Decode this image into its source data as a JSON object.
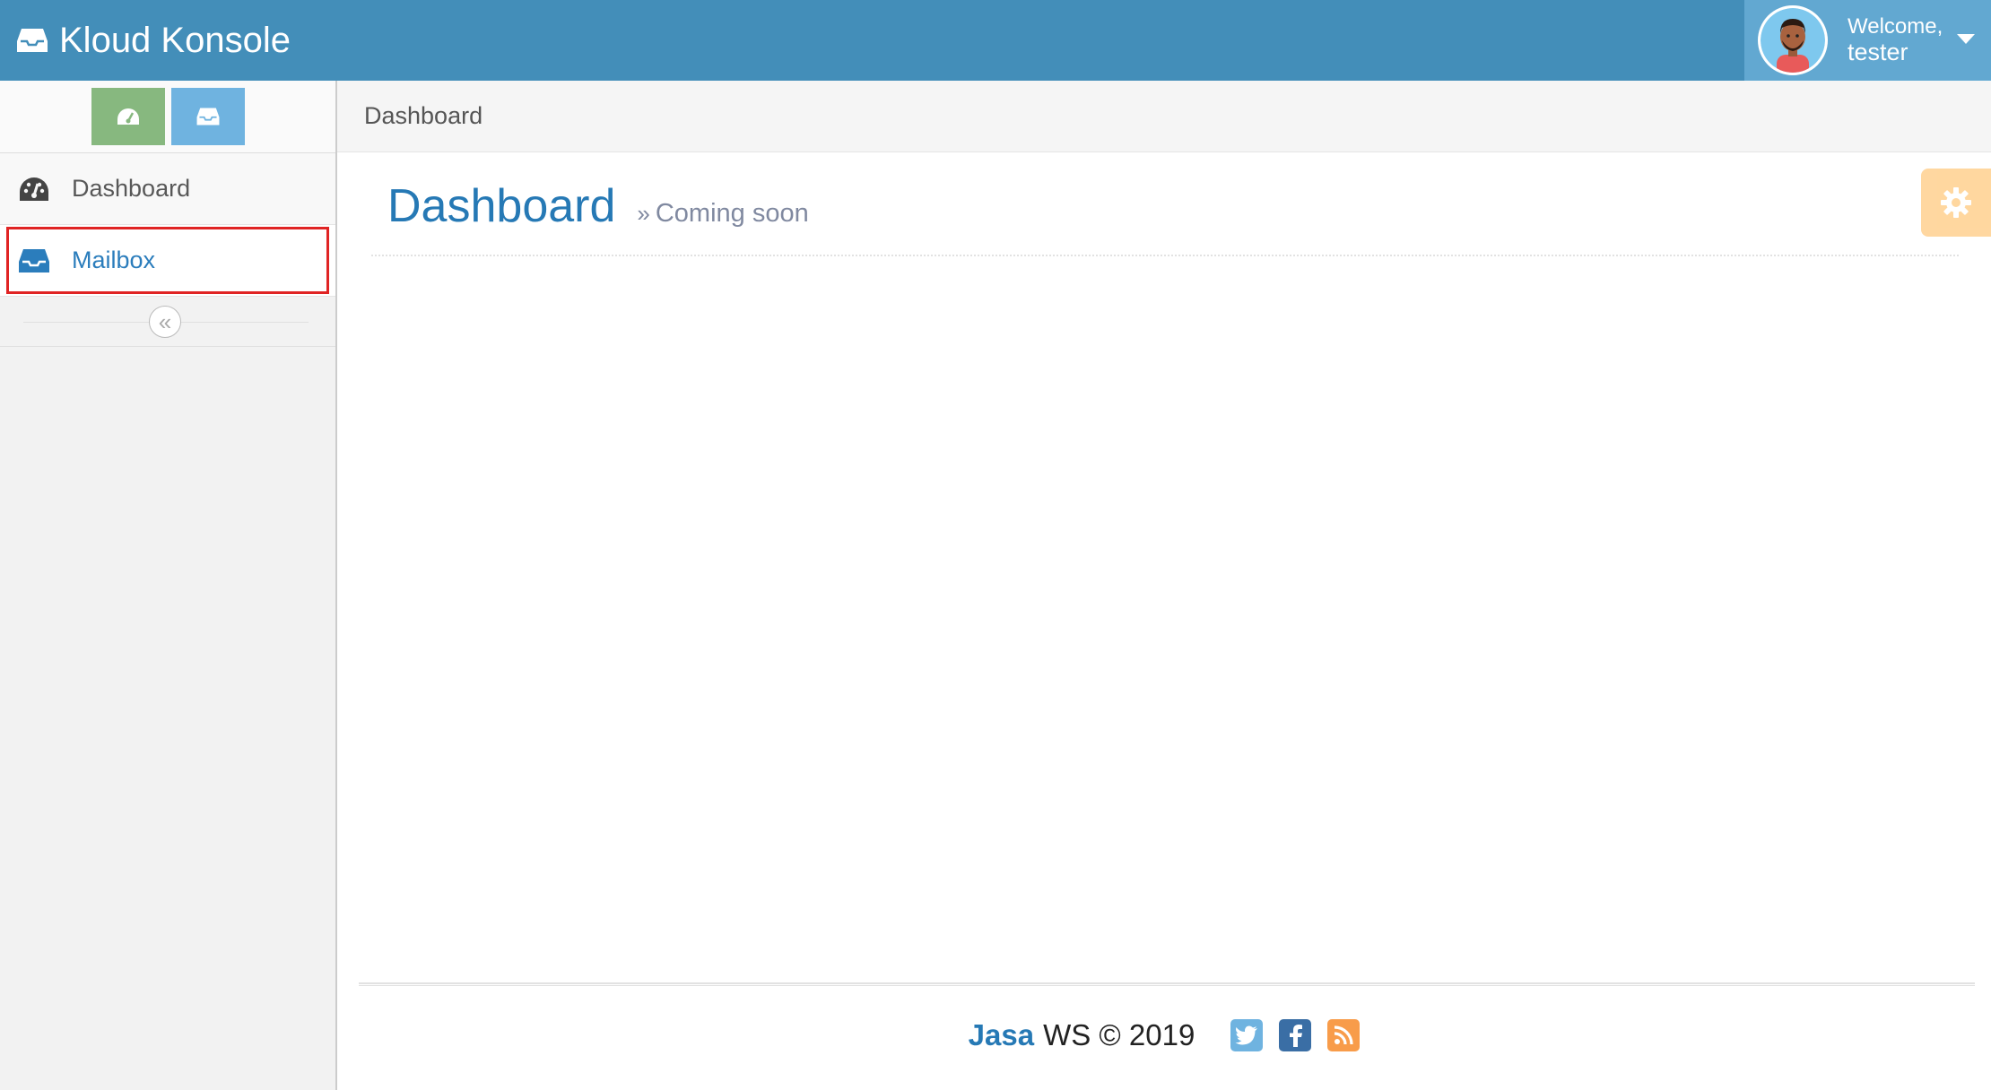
{
  "navbar": {
    "brand": "Kloud Konsole",
    "brand_icon": "inbox-icon",
    "user": {
      "welcome": "Welcome,",
      "name": "tester"
    },
    "colors": {
      "bar": "#438eb9",
      "user_menu": "#62a8d1"
    }
  },
  "sidebar": {
    "shortcuts": [
      {
        "icon": "dashboard-icon",
        "color": "#87b87f"
      },
      {
        "icon": "inbox-icon",
        "color": "#6fb3e0"
      }
    ],
    "items": [
      {
        "label": "Dashboard",
        "icon": "dashboard-icon",
        "active": false
      },
      {
        "label": "Mailbox",
        "icon": "inbox-icon",
        "active": true
      }
    ],
    "collapse_icon": "double-angle-left-icon"
  },
  "breadcrumb": {
    "current": "Dashboard"
  },
  "page": {
    "title": "Dashboard",
    "subtitle": "Coming soon"
  },
  "footer": {
    "brand": "Jasa",
    "text": "WS © 2019",
    "social": [
      "twitter-icon",
      "facebook-icon",
      "rss-icon"
    ]
  }
}
